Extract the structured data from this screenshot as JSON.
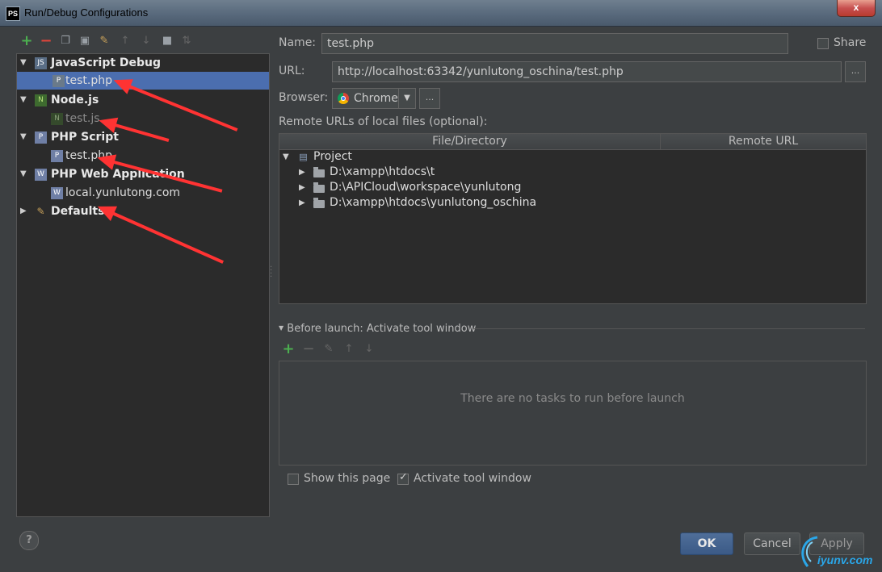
{
  "window": {
    "title": "Run/Debug Configurations",
    "app_badge": "PS",
    "close_label": "x"
  },
  "toolbar": {
    "icons": [
      "add-icon",
      "remove-icon",
      "copy-icon",
      "save-icon",
      "wrench-icon",
      "move-up-icon",
      "move-down-icon",
      "folder-icon",
      "sort-icon"
    ]
  },
  "tree": {
    "groups": [
      {
        "label": "JavaScript Debug",
        "expanded": true,
        "children": [
          "test.php"
        ]
      },
      {
        "label": "Node.js",
        "expanded": true,
        "children": [
          "test.js"
        ]
      },
      {
        "label": "PHP Script",
        "expanded": true,
        "children": [
          "test.php"
        ]
      },
      {
        "label": "PHP Web Application",
        "expanded": true,
        "children": [
          "local.yunlutong.com"
        ]
      },
      {
        "label": "Defaults",
        "expanded": false,
        "children": []
      }
    ],
    "selected": "JavaScript Debug / test.php"
  },
  "form": {
    "name_label": "Name:",
    "name_value": "test.php",
    "share_label": "Share",
    "share_checked": false,
    "url_label": "URL:",
    "url_value": "http://localhost:63342/yunlutong_oschina/test.php",
    "browser_label": "Browser:",
    "browser_value": "Chrome",
    "ellipsis": "...",
    "remote_urls_label": "Remote URLs of local files (optional):"
  },
  "table": {
    "columns": [
      "File/Directory",
      "Remote URL"
    ],
    "root": "Project",
    "rows": [
      "D:\\xampp\\htdocs\\t",
      "D:\\APICloud\\workspace\\yunlutong",
      "D:\\xampp\\htdocs\\yunlutong_oschina"
    ]
  },
  "before_launch": {
    "header": "Before launch: Activate tool window",
    "empty_message": "There are no tasks to run before launch",
    "show_page_label": "Show this page",
    "show_page_checked": false,
    "activate_label": "Activate tool window",
    "activate_checked": true
  },
  "buttons": {
    "ok": "OK",
    "cancel": "Cancel",
    "apply": "Apply",
    "help": "?"
  },
  "watermark": {
    "text": "iyunv.com"
  },
  "colors": {
    "background": "#3c3f41",
    "selection": "#4b6eaf",
    "annotation_arrow": "#ff3333",
    "add_green": "#4caf50",
    "remove_red": "#e0453a"
  }
}
